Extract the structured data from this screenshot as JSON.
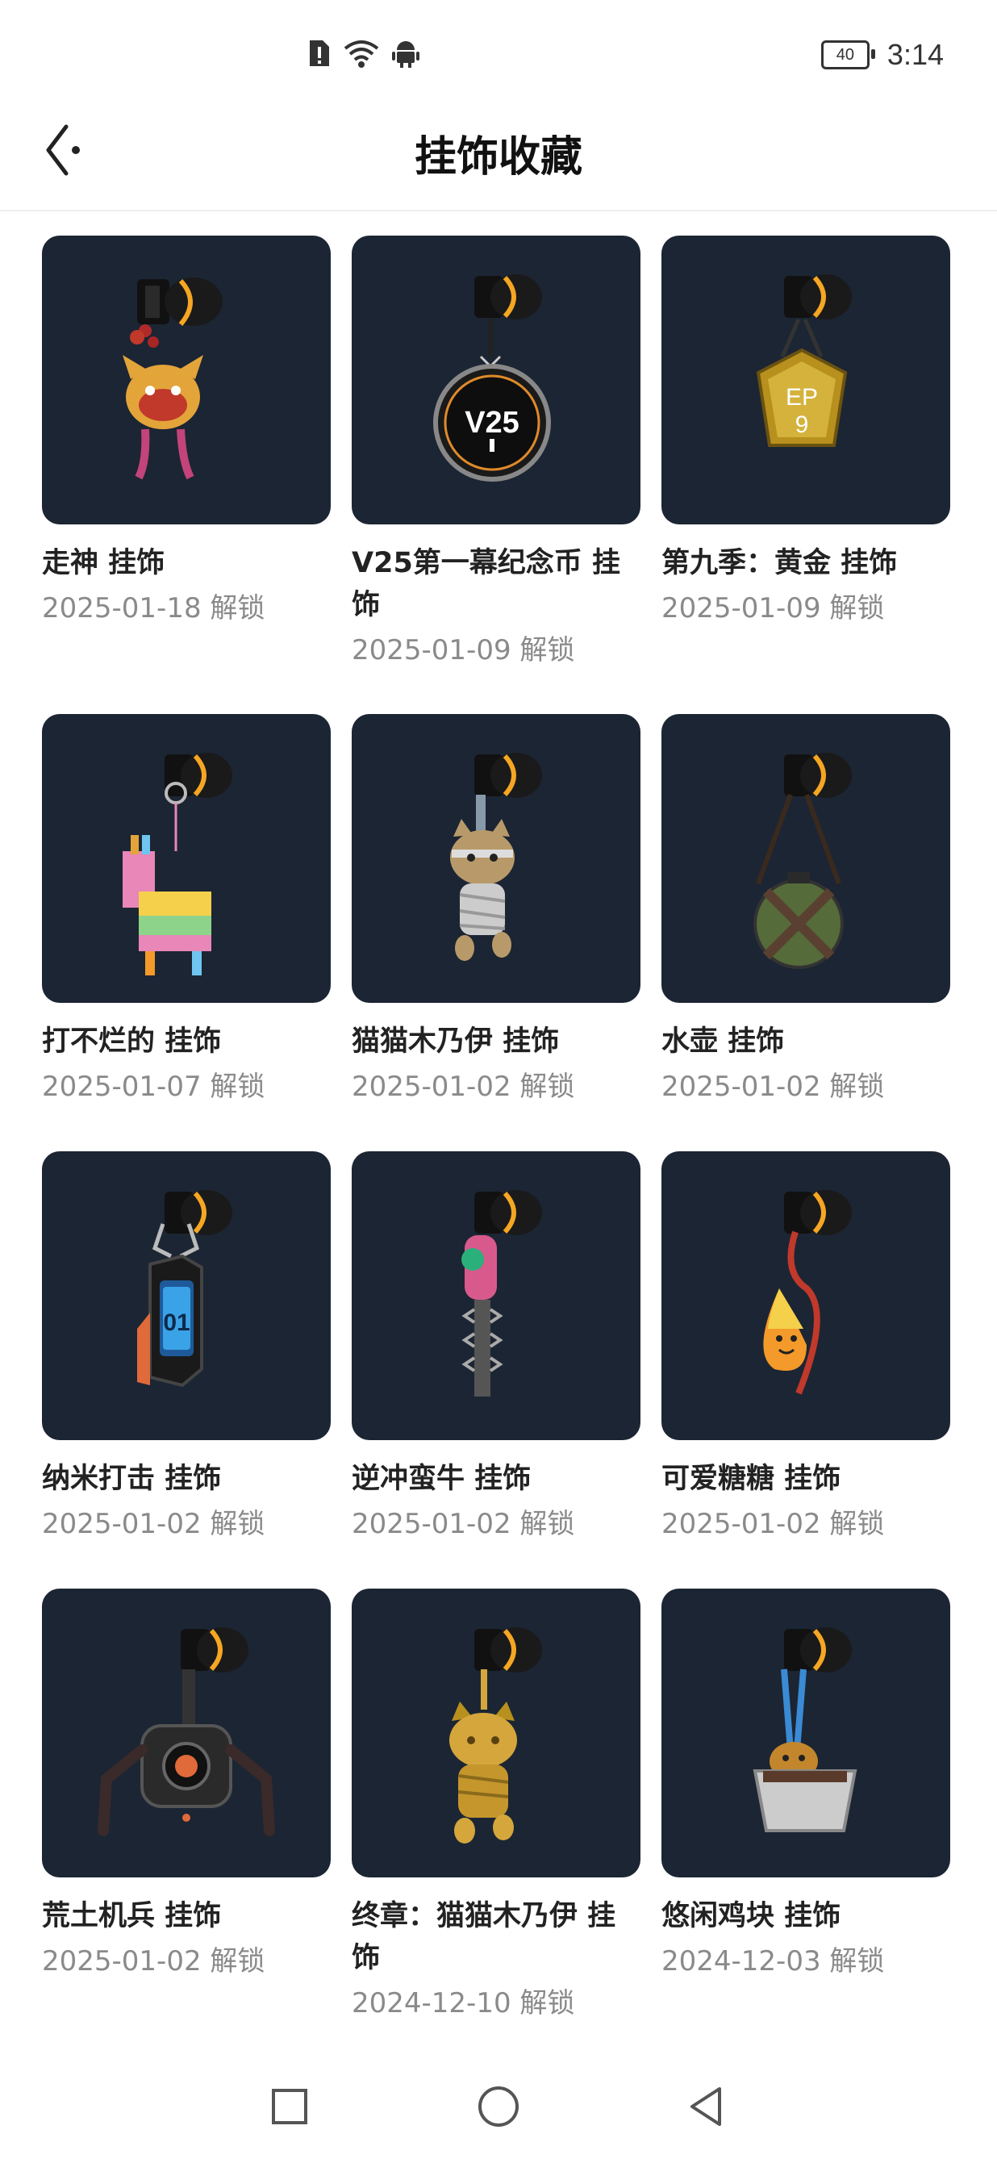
{
  "status": {
    "battery": "40",
    "time": "3:14",
    "icons": [
      "sim-alert-icon",
      "wifi-icon",
      "android-icon"
    ]
  },
  "header": {
    "title": "挂饰收藏",
    "back_icon": "back-arrow-icon"
  },
  "items": [
    {
      "name": "走神 挂饰",
      "date": "2025-01-18 解锁",
      "accent": "#e3a43a"
    },
    {
      "name": "V25第一幕纪念币 挂饰",
      "date": "2025-01-09 解锁",
      "accent": "#e08a2a"
    },
    {
      "name": "第九季：黄金 挂饰",
      "date": "2025-01-09 解锁",
      "accent": "#d4b23c"
    },
    {
      "name": "打不烂的 挂饰",
      "date": "2025-01-07 解锁",
      "accent": "#e887b8"
    },
    {
      "name": "猫猫木乃伊 挂饰",
      "date": "2025-01-02 解锁",
      "accent": "#b89a6a"
    },
    {
      "name": "水壶 挂饰",
      "date": "2025-01-02 解锁",
      "accent": "#556b3a"
    },
    {
      "name": "纳米打击 挂饰",
      "date": "2025-01-02 解锁",
      "accent": "#3aa3e8"
    },
    {
      "name": "逆冲蛮牛 挂饰",
      "date": "2025-01-02 解锁",
      "accent": "#d85a8c"
    },
    {
      "name": "可爱糖糖 挂饰",
      "date": "2025-01-02 解锁",
      "accent": "#f39a2a"
    },
    {
      "name": "荒土机兵 挂饰",
      "date": "2025-01-02 解锁",
      "accent": "#e06a3a"
    },
    {
      "name": "终章：猫猫木乃伊 挂饰",
      "date": "2024-12-10 解锁",
      "accent": "#d4a63c"
    },
    {
      "name": "悠闲鸡块 挂饰",
      "date": "2024-12-03 解锁",
      "accent": "#3a8ad4"
    }
  ],
  "navbar": {
    "icons": [
      "recent-apps-icon",
      "home-icon",
      "back-icon"
    ]
  }
}
